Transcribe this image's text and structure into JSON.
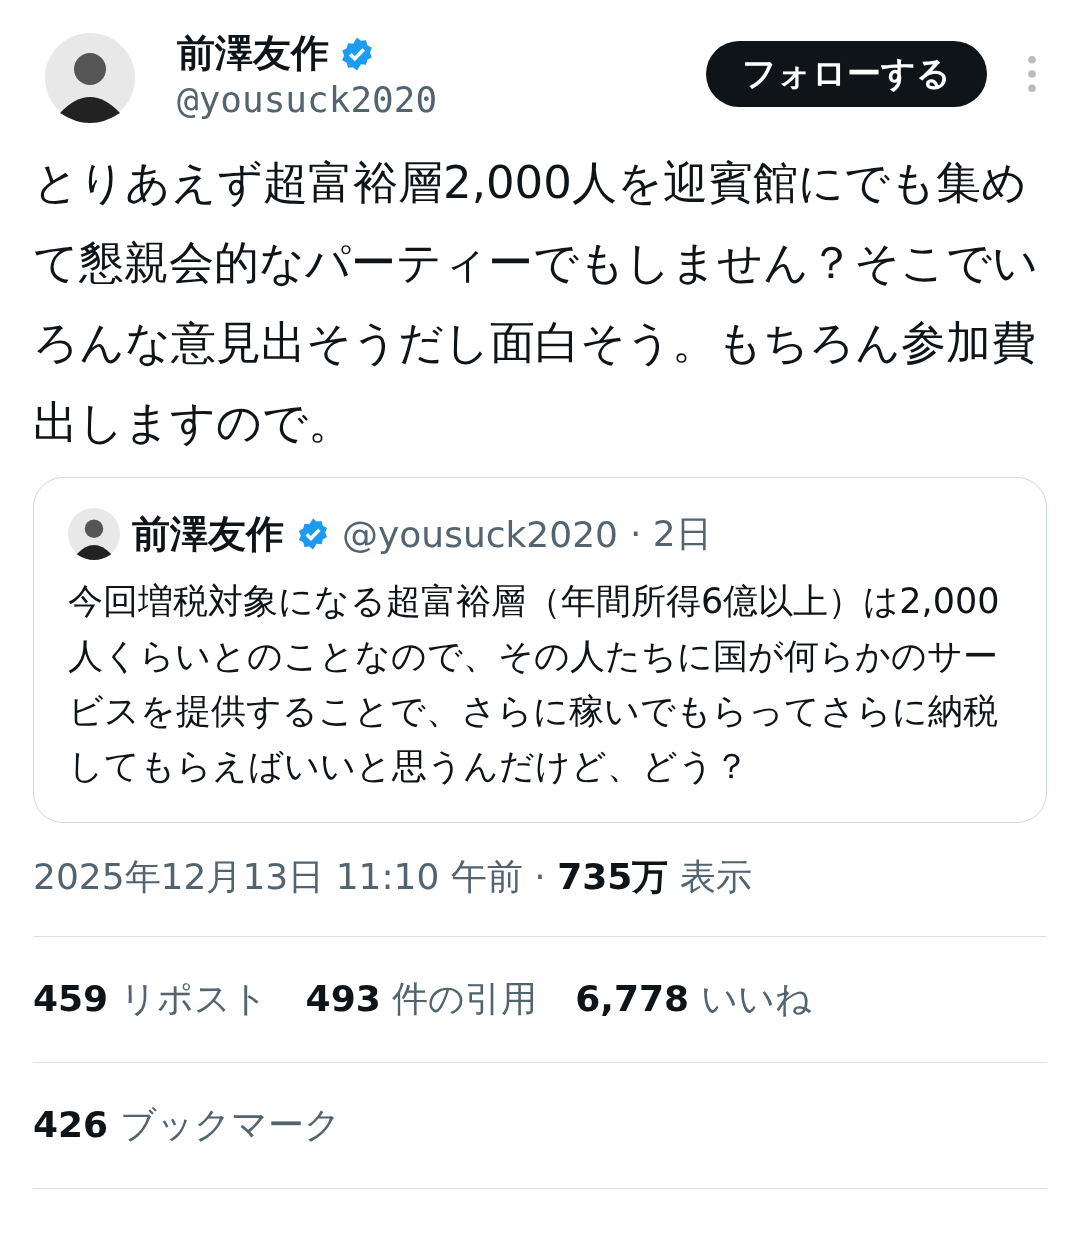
{
  "author": {
    "name": "前澤友作",
    "verified": true,
    "handle": "@yousuck2020"
  },
  "follow_button": "フォローする",
  "text": "とりあえず超富裕層2,000人を迎賓館にでも集めて懇親会的なパーティーでもしません？そこでいろんな意見出そうだし面白そう。もちろん参加費出しますので。",
  "quoted": {
    "name": "前澤友作",
    "verified": true,
    "handle": "@yousuck2020",
    "time": "· 2日",
    "text": "今回増税対象になる超富裕層（年間所得6億以上）は2,000人くらいとのことなので、その人たちに国が何らかのサービスを提供することで、さらに稼いでもらってさらに納税してもらえばいいと思うんだけど、どう？"
  },
  "meta": "2025年12月13日 11:10 午前 · **735万** 表示",
  "stats": [
    [
      {
        "count": "459",
        "label": "リポスト"
      },
      {
        "count": "493",
        "label": "件の引用"
      },
      {
        "count": "6,778",
        "label": "いいね"
      }
    ],
    [
      {
        "count": "426",
        "label": "ブックマーク"
      }
    ]
  ]
}
